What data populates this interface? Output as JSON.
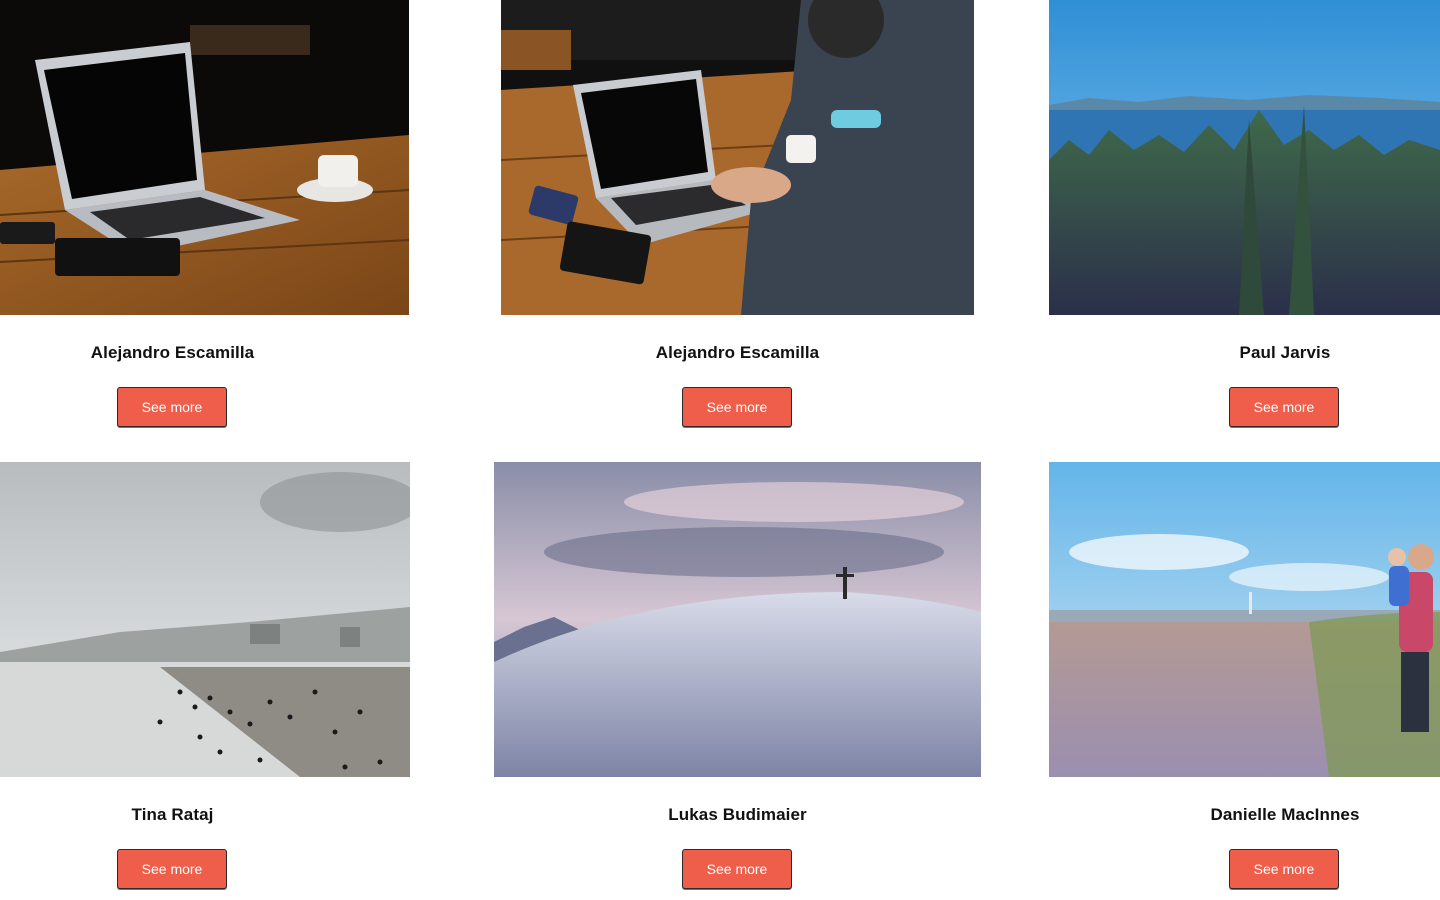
{
  "gallery": {
    "items": [
      {
        "author": "Alejandro Escamilla",
        "button": "See more",
        "image": "laptop-on-desk-photo"
      },
      {
        "author": "Alejandro Escamilla",
        "button": "See more",
        "image": "person-typing-laptop-photo"
      },
      {
        "author": "Paul Jarvis",
        "button": "See more",
        "image": "forest-lake-photo"
      },
      {
        "author": "Tina Rataj",
        "button": "See more",
        "image": "beach-crowd-photo"
      },
      {
        "author": "Lukas Budimaier",
        "button": "See more",
        "image": "snowy-mountain-cross-photo"
      },
      {
        "author": "Danielle MacInnes",
        "button": "See more",
        "image": "beach-father-child-photo"
      }
    ]
  },
  "colors": {
    "button_bg": "#ee5e4a",
    "button_text": "#ffffff",
    "page_bg": "#ffffff"
  }
}
